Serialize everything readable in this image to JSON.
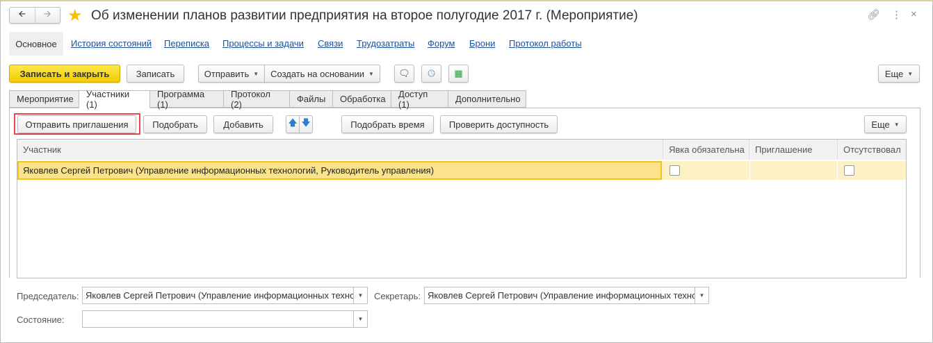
{
  "title": "Об изменении планов развитии предприятия на второе полугодие 2017 г. (Мероприятие)",
  "nav": {
    "active": "Основное",
    "links": [
      "История состояний",
      "Переписка",
      "Процессы и задачи",
      "Связи",
      "Трудозатраты",
      "Форум",
      "Брони",
      "Протокол работы"
    ]
  },
  "toolbar": {
    "save_close": "Записать и закрыть",
    "save": "Записать",
    "send": "Отправить",
    "create_based": "Создать на основании",
    "more": "Еще"
  },
  "tabs": [
    "Мероприятие",
    "Участники (1)",
    "Программа (1)",
    "Протокол (2)",
    "Файлы",
    "Обработка",
    "Доступ (1)",
    "Дополнительно"
  ],
  "inner_toolbar": {
    "send_invites": "Отправить приглашения",
    "pick": "Подобрать",
    "add": "Добавить",
    "pick_time": "Подобрать время",
    "check_avail": "Проверить доступность",
    "more": "Еще"
  },
  "table": {
    "columns": [
      "Участник",
      "Явка обязательна",
      "Приглашение",
      "Отсутствовал"
    ],
    "rows": [
      {
        "participant": "Яковлев Сергей Петрович (Управление информационных технологий, Руководитель управления)",
        "required": false,
        "invitation": "",
        "absent": false
      }
    ]
  },
  "fields": {
    "chair_label": "Председатель:",
    "chair_value": "Яковлев Сергей Петрович (Управление информационных технол",
    "secretary_label": "Секретарь:",
    "secretary_value": "Яковлев Сергей Петрович (Управление информационных технол",
    "state_label": "Состояние:",
    "state_value": ""
  }
}
